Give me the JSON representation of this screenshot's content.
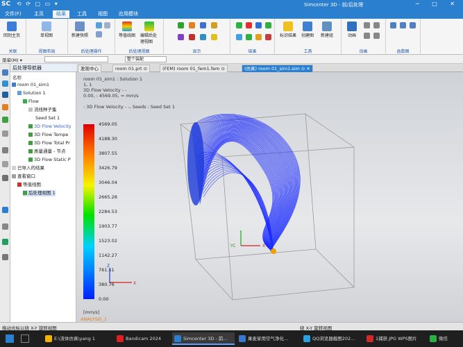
{
  "titlebar": {
    "logo": "SC",
    "quick_access": "⟲ ⟳ ▢ ▭ ▾",
    "app_title": "Simcenter 3D - 前/后处理",
    "win_buttons": "─ □ ✕"
  },
  "menu": [
    "文件(F)",
    "主页",
    "结果",
    "工具",
    "视图",
    "应用模块"
  ],
  "ribbon": {
    "groups": [
      {
        "label": "关联",
        "tools": [
          "回到主页"
        ]
      },
      {
        "label": "视图布局",
        "tools": [
          "单视图"
        ]
      },
      {
        "label": "后处理操作",
        "tools": [
          "新建快照"
        ]
      },
      {
        "label": "后处理视图",
        "tools": [
          "等值线图",
          "编辑后处理视图"
        ]
      },
      {
        "label": "显示",
        "tools": []
      },
      {
        "label": "结果",
        "tools": []
      },
      {
        "label": "工具",
        "tools": [
          "标识结果",
          "创建图",
          "新建组"
        ]
      },
      {
        "label": "动画",
        "tools": [
          "动画"
        ]
      },
      {
        "label": "函数图",
        "tools": []
      }
    ]
  },
  "selection_bar": {
    "menu_label": "菜单(M) ▾",
    "filter_value": "",
    "scope_value": "整个装配"
  },
  "navigator": {
    "title": "后处理导航器",
    "column": "名称",
    "items": [
      {
        "label": "room 01_sim1",
        "indent": 0
      },
      {
        "label": "Solution 1",
        "indent": 1
      },
      {
        "label": "Flow",
        "indent": 2
      },
      {
        "label": "流线种子集",
        "indent": 3
      },
      {
        "label": "Seed Set 1",
        "indent": 4
      },
      {
        "label": "3D Flow Velocity",
        "indent": 3
      },
      {
        "label": "3D Flow Tempe",
        "indent": 3
      },
      {
        "label": "3D Flow Total Pr",
        "indent": 3
      },
      {
        "label": "质量通量 - 节点",
        "indent": 3
      },
      {
        "label": "3D Flow Static P",
        "indent": 3
      },
      {
        "label": "已导入的结果",
        "indent": 0
      },
      {
        "label": "查看窗口",
        "indent": 0
      },
      {
        "label": "等值线图",
        "indent": 1
      },
      {
        "label": "后处理视图 1",
        "indent": 2
      }
    ]
  },
  "tabs": [
    {
      "label": "发现中心",
      "active": false
    },
    {
      "label": "room 01.prt ⊙",
      "active": false
    },
    {
      "label": "(FEM) room 01_fem1.fem ⊙",
      "active": false
    },
    {
      "label": "(仿真) room 01_sim1.sim ⊙ ✕",
      "active": true
    }
  ],
  "viewport": {
    "info": [
      "room 01_sim1 : Solution 1",
      "1, 1",
      "3D Flow Velocity - -",
      "0.00, : 4569.05, = mm/s",
      ": 3D Flow Velocity - -, Seeds : Seed Set 1"
    ],
    "legend_values": [
      "4569.05",
      "4188.30",
      "3807.55",
      "3426.79",
      "3046.04",
      "2665.28",
      "2284.53",
      "1903.77",
      "1523.02",
      "1142.27",
      "761.51",
      "380.76",
      "0.00"
    ],
    "legend_unit": "[mm/s]",
    "analysis_label": "ANALYSIS_1",
    "axis_labels": {
      "x": "X",
      "y": "Y",
      "z": "Z",
      "yc": "YC"
    }
  },
  "statusbar": {
    "left": "拖动光标以绕 X-Y 旋转视图",
    "center": "绕 X-Y 旋转视图"
  },
  "taskbar": {
    "items": [
      {
        "label": "E:\\流体仿真\\yang 1",
        "color": "#f0b400"
      },
      {
        "label": "Bandicam 2024",
        "color": "#e02020"
      },
      {
        "label": "Simcenter 3D - 前...",
        "color": "#2b7fcf"
      },
      {
        "label": "果麦家用空气净化...",
        "color": "#3a78d0"
      },
      {
        "label": "QQ浏览器截图202...",
        "color": "#2aa0e0"
      },
      {
        "label": "1捕获.JPG WPS图片",
        "color": "#d02a2a"
      },
      {
        "label": "微信",
        "color": "#2ab040"
      }
    ]
  }
}
